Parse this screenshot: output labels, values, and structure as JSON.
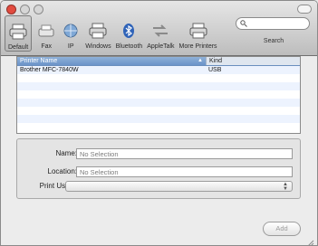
{
  "window": {
    "traffic_lights": [
      "close",
      "minimize",
      "zoom"
    ]
  },
  "toolbar": {
    "items": [
      {
        "label": "Default",
        "icon": "default-printer-icon",
        "selected": true
      },
      {
        "label": "Fax",
        "icon": "fax-icon"
      },
      {
        "label": "IP",
        "icon": "globe-icon"
      },
      {
        "label": "Windows",
        "icon": "windows-printer-icon"
      },
      {
        "label": "Bluetooth",
        "icon": "bluetooth-icon"
      },
      {
        "label": "AppleTalk",
        "icon": "appletalk-icon"
      },
      {
        "label": "More Printers",
        "icon": "more-printers-icon"
      }
    ],
    "search_label": "Search",
    "search_placeholder": ""
  },
  "printer_list": {
    "columns": [
      "Printer Name",
      "Kind"
    ],
    "rows": [
      {
        "name": "Brother MFC-7840W",
        "kind": "USB"
      }
    ]
  },
  "form": {
    "name_label": "Name:",
    "name_value": "No Selection",
    "location_label": "Location:",
    "location_value": "No Selection",
    "print_using_label": "Print Using:",
    "print_using_value": ""
  },
  "buttons": {
    "add": "Add"
  },
  "colors": {
    "selection_header": "#7aa0d0",
    "alt_row": "#edf3fe",
    "close_light": "#e24b3f"
  }
}
